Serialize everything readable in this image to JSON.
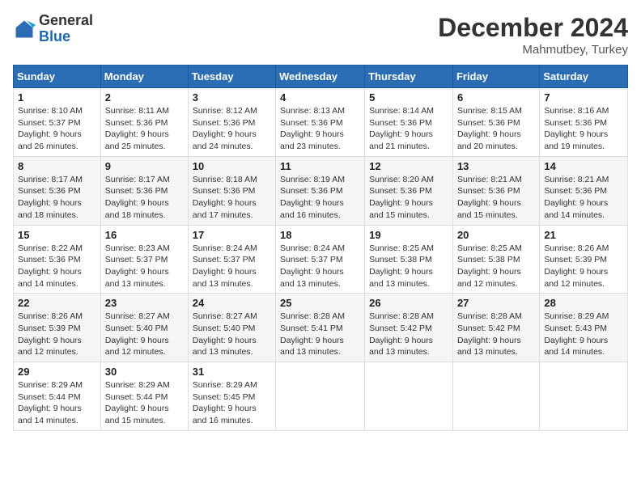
{
  "header": {
    "logo_general": "General",
    "logo_blue": "Blue",
    "month_title": "December 2024",
    "location": "Mahmutbey, Turkey"
  },
  "days_of_week": [
    "Sunday",
    "Monday",
    "Tuesday",
    "Wednesday",
    "Thursday",
    "Friday",
    "Saturday"
  ],
  "weeks": [
    [
      {
        "day": "1",
        "sunrise": "8:10 AM",
        "sunset": "5:37 PM",
        "daylight_h": "9",
        "daylight_m": "26"
      },
      {
        "day": "2",
        "sunrise": "8:11 AM",
        "sunset": "5:36 PM",
        "daylight_h": "9",
        "daylight_m": "25"
      },
      {
        "day": "3",
        "sunrise": "8:12 AM",
        "sunset": "5:36 PM",
        "daylight_h": "9",
        "daylight_m": "24"
      },
      {
        "day": "4",
        "sunrise": "8:13 AM",
        "sunset": "5:36 PM",
        "daylight_h": "9",
        "daylight_m": "23"
      },
      {
        "day": "5",
        "sunrise": "8:14 AM",
        "sunset": "5:36 PM",
        "daylight_h": "9",
        "daylight_m": "21"
      },
      {
        "day": "6",
        "sunrise": "8:15 AM",
        "sunset": "5:36 PM",
        "daylight_h": "9",
        "daylight_m": "20"
      },
      {
        "day": "7",
        "sunrise": "8:16 AM",
        "sunset": "5:36 PM",
        "daylight_h": "9",
        "daylight_m": "19"
      }
    ],
    [
      {
        "day": "8",
        "sunrise": "8:17 AM",
        "sunset": "5:36 PM",
        "daylight_h": "9",
        "daylight_m": "18"
      },
      {
        "day": "9",
        "sunrise": "8:17 AM",
        "sunset": "5:36 PM",
        "daylight_h": "9",
        "daylight_m": "18"
      },
      {
        "day": "10",
        "sunrise": "8:18 AM",
        "sunset": "5:36 PM",
        "daylight_h": "9",
        "daylight_m": "17"
      },
      {
        "day": "11",
        "sunrise": "8:19 AM",
        "sunset": "5:36 PM",
        "daylight_h": "9",
        "daylight_m": "16"
      },
      {
        "day": "12",
        "sunrise": "8:20 AM",
        "sunset": "5:36 PM",
        "daylight_h": "9",
        "daylight_m": "15"
      },
      {
        "day": "13",
        "sunrise": "8:21 AM",
        "sunset": "5:36 PM",
        "daylight_h": "9",
        "daylight_m": "15"
      },
      {
        "day": "14",
        "sunrise": "8:21 AM",
        "sunset": "5:36 PM",
        "daylight_h": "9",
        "daylight_m": "14"
      }
    ],
    [
      {
        "day": "15",
        "sunrise": "8:22 AM",
        "sunset": "5:36 PM",
        "daylight_h": "9",
        "daylight_m": "14"
      },
      {
        "day": "16",
        "sunrise": "8:23 AM",
        "sunset": "5:37 PM",
        "daylight_h": "9",
        "daylight_m": "13"
      },
      {
        "day": "17",
        "sunrise": "8:24 AM",
        "sunset": "5:37 PM",
        "daylight_h": "9",
        "daylight_m": "13"
      },
      {
        "day": "18",
        "sunrise": "8:24 AM",
        "sunset": "5:37 PM",
        "daylight_h": "9",
        "daylight_m": "13"
      },
      {
        "day": "19",
        "sunrise": "8:25 AM",
        "sunset": "5:38 PM",
        "daylight_h": "9",
        "daylight_m": "13"
      },
      {
        "day": "20",
        "sunrise": "8:25 AM",
        "sunset": "5:38 PM",
        "daylight_h": "9",
        "daylight_m": "12"
      },
      {
        "day": "21",
        "sunrise": "8:26 AM",
        "sunset": "5:39 PM",
        "daylight_h": "9",
        "daylight_m": "12"
      }
    ],
    [
      {
        "day": "22",
        "sunrise": "8:26 AM",
        "sunset": "5:39 PM",
        "daylight_h": "9",
        "daylight_m": "12"
      },
      {
        "day": "23",
        "sunrise": "8:27 AM",
        "sunset": "5:40 PM",
        "daylight_h": "9",
        "daylight_m": "12"
      },
      {
        "day": "24",
        "sunrise": "8:27 AM",
        "sunset": "5:40 PM",
        "daylight_h": "9",
        "daylight_m": "13"
      },
      {
        "day": "25",
        "sunrise": "8:28 AM",
        "sunset": "5:41 PM",
        "daylight_h": "9",
        "daylight_m": "13"
      },
      {
        "day": "26",
        "sunrise": "8:28 AM",
        "sunset": "5:42 PM",
        "daylight_h": "9",
        "daylight_m": "13"
      },
      {
        "day": "27",
        "sunrise": "8:28 AM",
        "sunset": "5:42 PM",
        "daylight_h": "9",
        "daylight_m": "13"
      },
      {
        "day": "28",
        "sunrise": "8:29 AM",
        "sunset": "5:43 PM",
        "daylight_h": "9",
        "daylight_m": "14"
      }
    ],
    [
      {
        "day": "29",
        "sunrise": "8:29 AM",
        "sunset": "5:44 PM",
        "daylight_h": "9",
        "daylight_m": "14"
      },
      {
        "day": "30",
        "sunrise": "8:29 AM",
        "sunset": "5:44 PM",
        "daylight_h": "9",
        "daylight_m": "15"
      },
      {
        "day": "31",
        "sunrise": "8:29 AM",
        "sunset": "5:45 PM",
        "daylight_h": "9",
        "daylight_m": "16"
      },
      null,
      null,
      null,
      null
    ]
  ],
  "labels": {
    "sunrise": "Sunrise:",
    "sunset": "Sunset:",
    "daylight": "Daylight:",
    "hours": "hours",
    "and": "and",
    "minutes": "minutes."
  }
}
